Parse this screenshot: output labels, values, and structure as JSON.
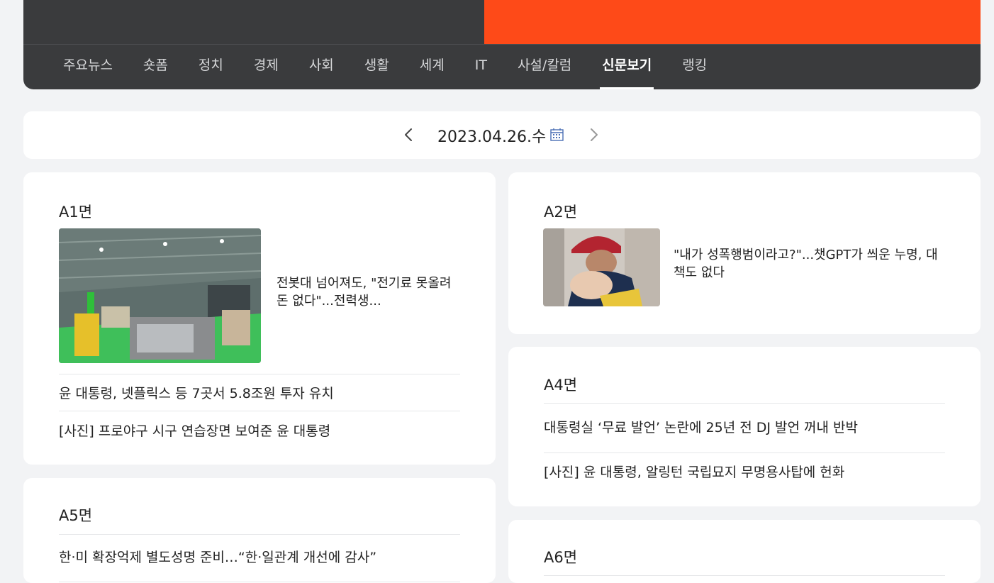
{
  "nav": {
    "items": [
      {
        "label": "주요뉴스"
      },
      {
        "label": "숏폼"
      },
      {
        "label": "정치"
      },
      {
        "label": "경제"
      },
      {
        "label": "사회"
      },
      {
        "label": "생활"
      },
      {
        "label": "세계"
      },
      {
        "label": "IT"
      },
      {
        "label": "사설/칼럼"
      },
      {
        "label": "신문보기"
      },
      {
        "label": "랭킹"
      }
    ],
    "active": "신문보기"
  },
  "date": {
    "text": "2023.04.26.수"
  },
  "pages": {
    "a1": {
      "title": "A1면",
      "lead": "전봇대 넘어져도, \"전기료 못올려 돈 없다\"...전력생...",
      "items": [
        "윤 대통령, 넷플릭스 등 7곳서 5.8조원 투자 유치",
        "[사진] 프로야구 시구 연습장면 보여준 윤 대통령"
      ]
    },
    "a2": {
      "title": "A2면",
      "lead": "\"내가 성폭행범이라고?\"...챗GPT가 씌운 누명, 대책도 없다"
    },
    "a4": {
      "title": "A4면",
      "items": [
        "대통령실 ‘무료 발언’ 논란에 25년 전 DJ 발언 꺼내 반박",
        "[사진] 윤 대통령, 알링턴 국립묘지 무명용사탑에 헌화"
      ]
    },
    "a5": {
      "title": "A5면",
      "items": [
        "한·미 확장억제 별도성명 준비…“한·일관계 개선에 감사”"
      ]
    },
    "a6": {
      "title": "A6면"
    }
  },
  "colors": {
    "header": "#3a3b3d",
    "accent": "#fe4a18",
    "background": "#f2f3f5"
  }
}
